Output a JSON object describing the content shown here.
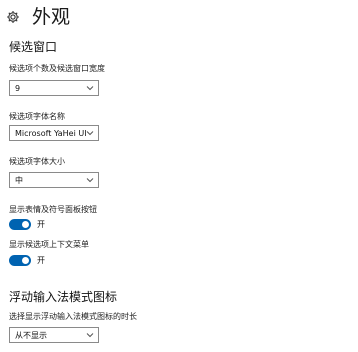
{
  "header": {
    "title": "外观",
    "icon": "gear-icon"
  },
  "candidate_window": {
    "section_title": "候选窗口",
    "count_width": {
      "label": "候选项个数及候选窗口宽度",
      "value": "9"
    },
    "font_name": {
      "label": "候选项字体名称",
      "value": "Microsoft YaHei UI"
    },
    "font_size": {
      "label": "候选项字体大小",
      "value": "中"
    },
    "emoji_button": {
      "label": "显示表情及符号面板按钮",
      "state": "开",
      "on": true
    },
    "context_menu": {
      "label": "显示候选项上下文菜单",
      "state": "开",
      "on": true
    }
  },
  "floating_icon": {
    "section_title": "浮动输入法模式图标",
    "duration": {
      "label": "选择显示浮动输入法模式图标的时长",
      "value": "从不显示"
    }
  },
  "colors": {
    "accent": "#0063b1"
  }
}
